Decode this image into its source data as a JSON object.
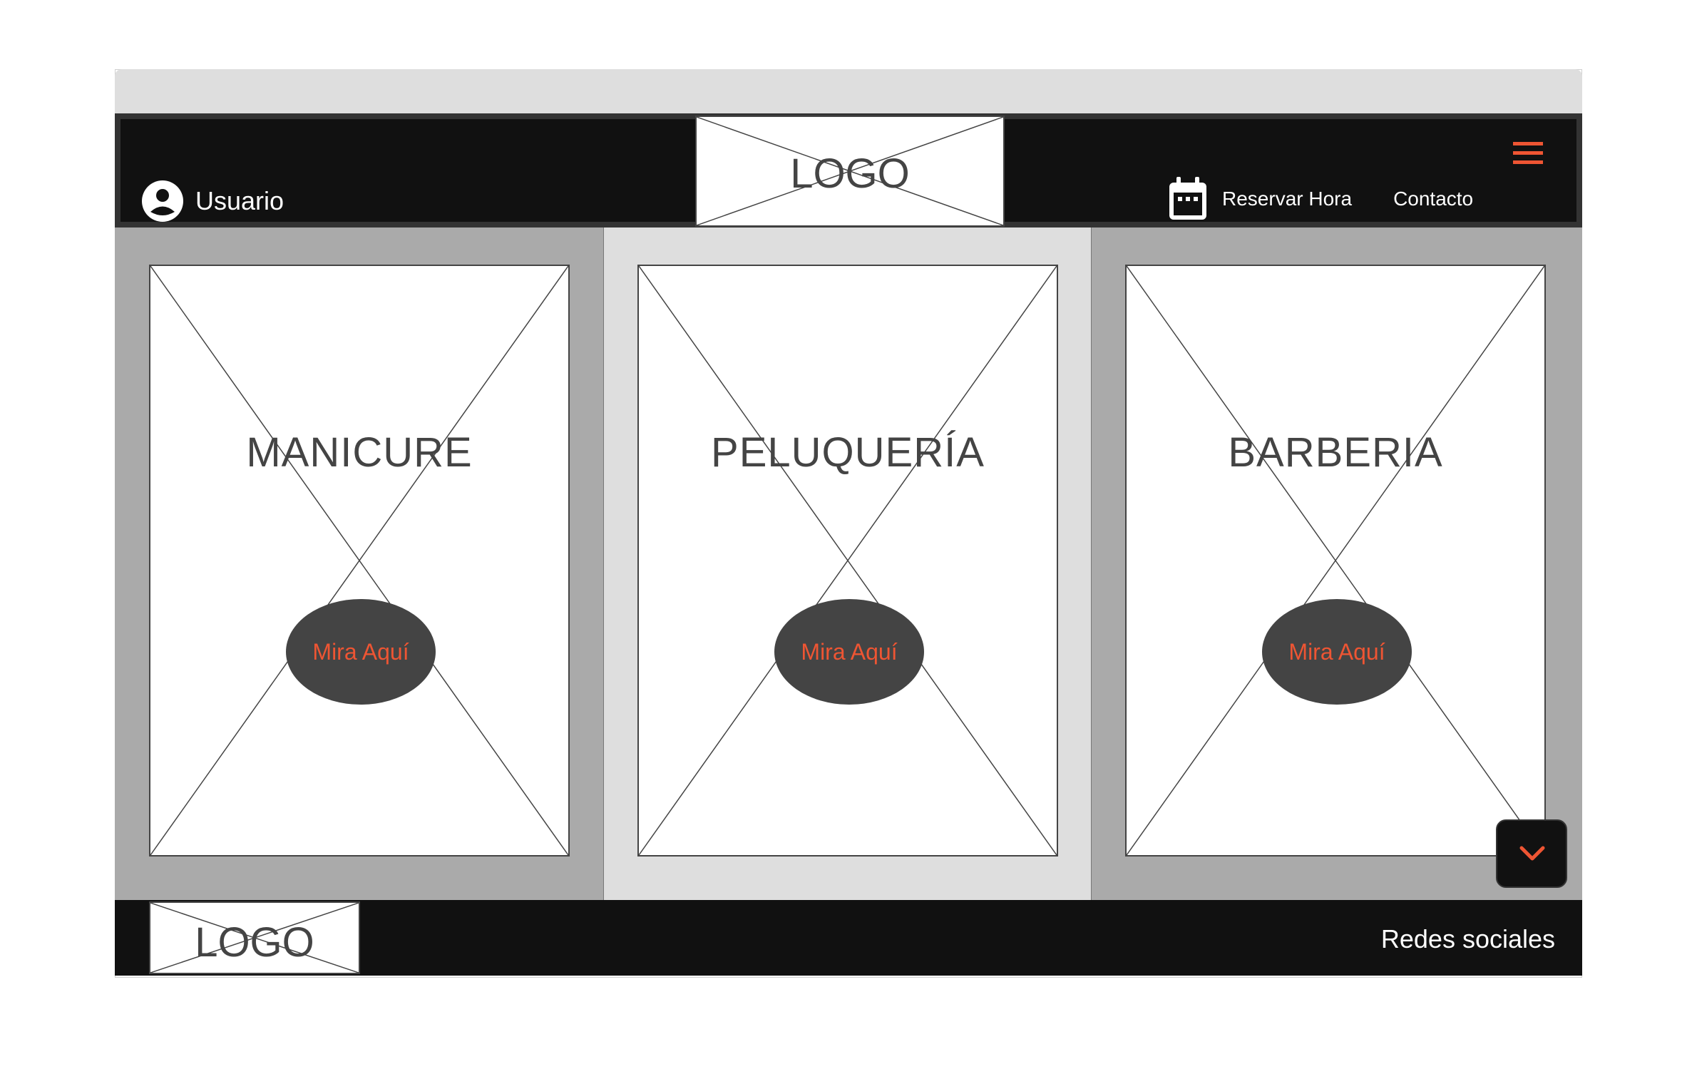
{
  "header": {
    "user_label": "Usuario",
    "logo_text": "LOGO",
    "nav": {
      "reserve_label": "Reservar Hora",
      "contact_label": "Contacto"
    }
  },
  "services": [
    {
      "title": "MANICURE",
      "cta": "Mira Aquí"
    },
    {
      "title": "PELUQUERÍA",
      "cta": "Mira Aquí"
    },
    {
      "title": "BARBERIA",
      "cta": "Mira Aquí"
    }
  ],
  "footer": {
    "logo_text": "LOGO",
    "social_label": "Redes sociales"
  },
  "colors": {
    "accent": "#ee5533",
    "header_bg": "#111111",
    "panel_dark": "#aaaaaa",
    "panel_light": "#dedede",
    "cta_bg": "#444444"
  },
  "icons": {
    "user": "user-circle-icon",
    "calendar": "calendar-icon",
    "menu": "hamburger-menu-icon",
    "scroll": "chevron-down-icon"
  }
}
